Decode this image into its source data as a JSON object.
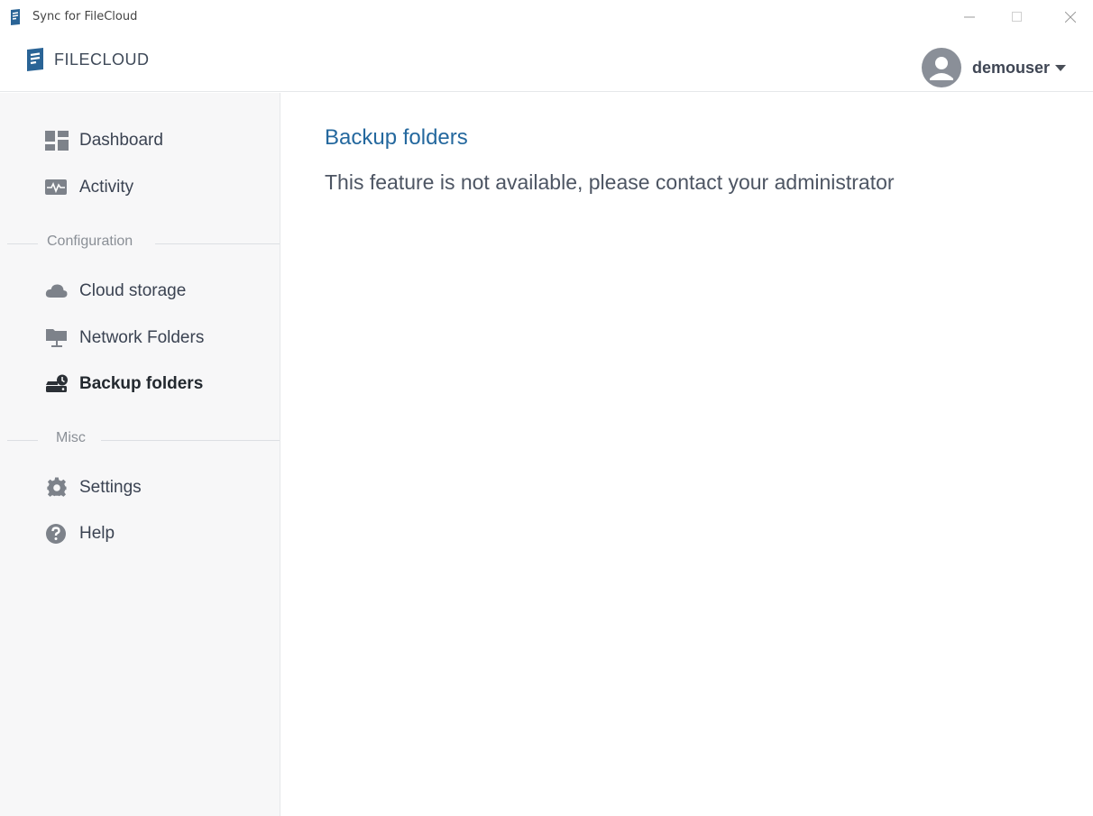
{
  "window": {
    "title": "Sync for FileCloud"
  },
  "header": {
    "logo_text": "FILECLOUD",
    "user_name": "demouser"
  },
  "sidebar": {
    "items": [
      {
        "label": "Dashboard",
        "icon": "dashboard-icon"
      },
      {
        "label": "Activity",
        "icon": "activity-icon"
      }
    ],
    "configuration_label": "Configuration",
    "config_items": [
      {
        "label": "Cloud storage",
        "icon": "cloud-icon"
      },
      {
        "label": "Network Folders",
        "icon": "network-folder-icon"
      },
      {
        "label": "Backup folders",
        "icon": "backup-icon",
        "active": true
      }
    ],
    "misc_label": "Misc",
    "misc_items": [
      {
        "label": "Settings",
        "icon": "gear-icon"
      },
      {
        "label": "Help",
        "icon": "help-icon"
      }
    ]
  },
  "main": {
    "title": "Backup folders",
    "message": "This feature is not available, please contact your administrator"
  },
  "colors": {
    "accent": "#24689e",
    "icon_gray": "#7d828a",
    "active_icon": "#2b3036"
  }
}
